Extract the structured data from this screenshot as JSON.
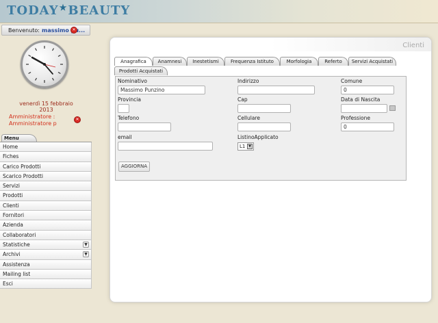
{
  "app": {
    "logo_left": "TODAY",
    "logo_right": "BEAUTY"
  },
  "welcome": {
    "label": "Benvenuto:",
    "user": "massimo pu..."
  },
  "date": "venerdì 15 febbraio 2013",
  "admin": {
    "line1": "Amministratore :",
    "line2": "Amministratore p"
  },
  "menu": {
    "tab": "Menu",
    "items": [
      {
        "label": "Home"
      },
      {
        "label": "Fiches"
      },
      {
        "label": "Carico Prodotti"
      },
      {
        "label": "Scarico Prodotti"
      },
      {
        "label": "Servizi"
      },
      {
        "label": "Prodotti"
      },
      {
        "label": "Clienti"
      },
      {
        "label": "Fornitori"
      },
      {
        "label": "Azienda"
      },
      {
        "label": "Collaboratori"
      },
      {
        "label": "Statistiche"
      },
      {
        "label": "Archivi"
      },
      {
        "label": "Assistenza"
      },
      {
        "label": "Mailing list"
      },
      {
        "label": "Esci"
      }
    ]
  },
  "panel": {
    "title": "Clienti"
  },
  "tabs": [
    "Anagrafica",
    "Anamnesi",
    "Inestetismi",
    "Frequenza Istituto",
    "Morfologia",
    "Referto",
    "Servizi Acquistati",
    "Prodotti Acquistati"
  ],
  "form": {
    "nominativo": {
      "label": "Nominativo",
      "value": "Massimo Punzino"
    },
    "indirizzo": {
      "label": "Indirizzo",
      "value": ""
    },
    "comune": {
      "label": "Comune",
      "value": "0"
    },
    "provincia": {
      "label": "Provincia",
      "value": ""
    },
    "cap": {
      "label": "Cap",
      "value": ""
    },
    "data_nascita": {
      "label": "Data di Nascita",
      "value": ""
    },
    "telefono": {
      "label": "Telefono",
      "value": ""
    },
    "cellulare": {
      "label": "Cellulare",
      "value": ""
    },
    "professione": {
      "label": "Professione",
      "value": "0"
    },
    "email": {
      "label": "email",
      "value": ""
    },
    "listino": {
      "label": "ListinoApplicato",
      "value": "L1"
    },
    "submit": "AGGIORNA"
  },
  "colors": {
    "accent_red": "#d22e1a",
    "logo_blue": "#3e7da3",
    "user_blue": "#2a4f9e"
  }
}
